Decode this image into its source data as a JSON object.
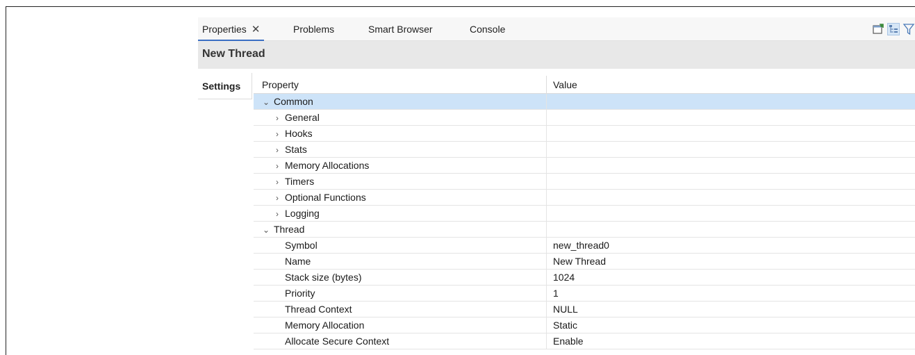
{
  "tabs": [
    {
      "label": "Properties",
      "active": true,
      "closable": true
    },
    {
      "label": "Problems"
    },
    {
      "label": "Smart Browser"
    },
    {
      "label": "Console"
    }
  ],
  "toolbar_icons": [
    "new-window-icon",
    "tree-view-icon",
    "filter-icon"
  ],
  "title": "New Thread",
  "side_tabs": [
    {
      "label": "Settings"
    }
  ],
  "table": {
    "headers": {
      "property": "Property",
      "value": "Value"
    },
    "rows": [
      {
        "label": "Common",
        "value": "",
        "expanded": true
      },
      {
        "label": "General",
        "value": ""
      },
      {
        "label": "Hooks",
        "value": ""
      },
      {
        "label": "Stats",
        "value": ""
      },
      {
        "label": "Memory Allocations",
        "value": ""
      },
      {
        "label": "Timers",
        "value": ""
      },
      {
        "label": "Optional Functions",
        "value": ""
      },
      {
        "label": "Logging",
        "value": ""
      },
      {
        "label": "Thread",
        "value": "",
        "expanded": true
      },
      {
        "label": "Symbol",
        "value": "new_thread0"
      },
      {
        "label": "Name",
        "value": "New Thread"
      },
      {
        "label": "Stack size (bytes)",
        "value": "1024"
      },
      {
        "label": "Priority",
        "value": "1"
      },
      {
        "label": "Thread Context",
        "value": "NULL"
      },
      {
        "label": "Memory Allocation",
        "value": "Static"
      },
      {
        "label": "Allocate Secure Context",
        "value": "Enable"
      }
    ]
  },
  "colors": {
    "selected_row": "#cde3f8",
    "active_tab_underline": "#3b6fc4",
    "title_bar": "#e8e8e8"
  }
}
